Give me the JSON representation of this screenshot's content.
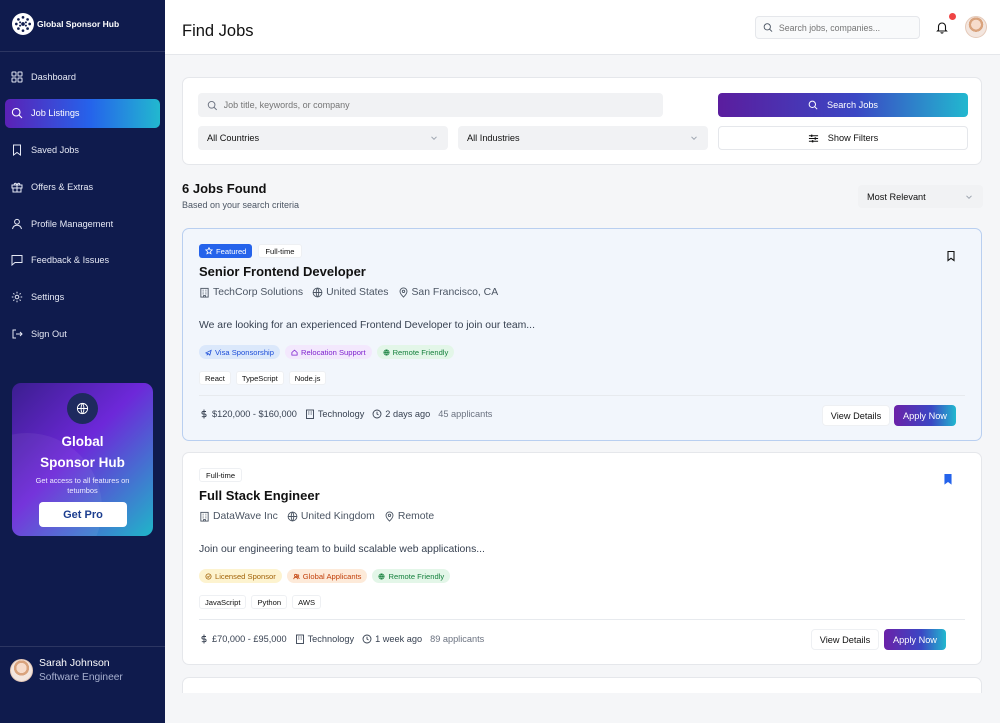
{
  "brand": {
    "name": "Global Sponsor Hub"
  },
  "sidebar": {
    "items": [
      {
        "label": "Dashboard",
        "icon": "dashboard-icon"
      },
      {
        "label": "Job Listings",
        "icon": "search-icon",
        "active": true
      },
      {
        "label": "Saved Jobs",
        "icon": "bookmark-icon"
      },
      {
        "label": "Offers & Extras",
        "icon": "gift-icon"
      },
      {
        "label": "Profile Management",
        "icon": "user-icon"
      },
      {
        "label": "Feedback & Issues",
        "icon": "message-icon"
      },
      {
        "label": "Settings",
        "icon": "gear-icon"
      },
      {
        "label": "Sign Out",
        "icon": "sign-out-icon"
      }
    ],
    "promo": {
      "title_line1": "Global",
      "title_line2": "Sponsor Hub",
      "description": "Get access to all features on tetumbos",
      "button": "Get Pro"
    },
    "user": {
      "name": "Sarah Johnson",
      "role": "Software Engineer"
    }
  },
  "header": {
    "title": "Find Jobs",
    "search_placeholder": "Search jobs, companies..."
  },
  "search": {
    "placeholder": "Job title, keywords, or company",
    "button": "Search Jobs",
    "country": "All Countries",
    "industry": "All Industries",
    "filters_button": "Show Filters"
  },
  "results": {
    "title": "6 Jobs Found",
    "subtitle": "Based on your search criteria",
    "sort": "Most Relevant"
  },
  "jobs": [
    {
      "featured_label": "Featured",
      "type": "Full-time",
      "title": "Senior Frontend Developer",
      "company": "TechCorp Solutions",
      "country": "United States",
      "location": "San Francisco, CA",
      "description": "We are looking for an experienced Frontend Developer to join our team...",
      "perks": [
        "Visa Sponsorship",
        "Relocation Support",
        "Remote Friendly"
      ],
      "skills": [
        "React",
        "TypeScript",
        "Node.js"
      ],
      "salary": "$120,000 - $160,000",
      "industry": "Technology",
      "posted": "2 days ago",
      "applicants": "45 applicants",
      "view_label": "View Details",
      "apply_label": "Apply Now",
      "saved": false
    },
    {
      "type": "Full-time",
      "title": "Full Stack Engineer",
      "company": "DataWave Inc",
      "country": "United Kingdom",
      "location": "Remote",
      "description": "Join our engineering team to build scalable web applications...",
      "perks": [
        "Licensed Sponsor",
        "Global Applicants",
        "Remote Friendly"
      ],
      "skills": [
        "JavaScript",
        "Python",
        "AWS"
      ],
      "salary": "£70,000 - £95,000",
      "industry": "Technology",
      "posted": "1 week ago",
      "applicants": "89 applicants",
      "view_label": "View Details",
      "apply_label": "Apply Now",
      "saved": true
    }
  ],
  "colors": {
    "sidebar_bg": "#0f1b4d",
    "accent_gradient_start": "#5b21b6",
    "accent_gradient_end": "#22b8cf",
    "featured_badge": "#2563eb",
    "notification_dot": "#ef4444"
  }
}
